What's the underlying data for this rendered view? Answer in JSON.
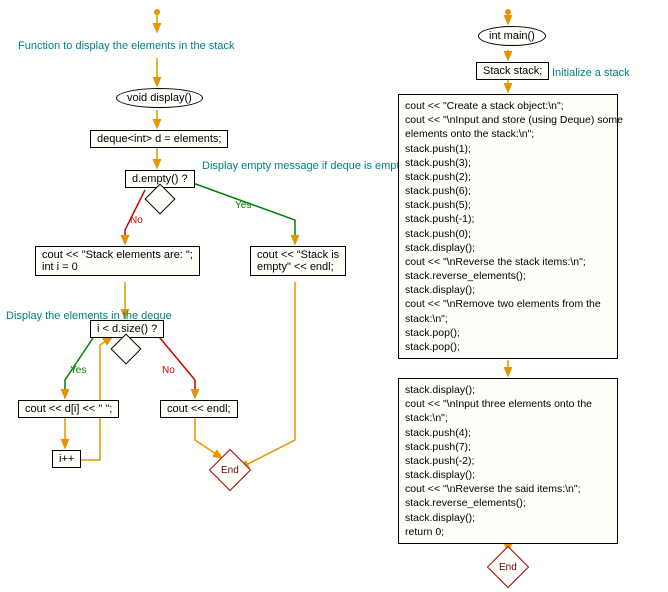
{
  "left": {
    "title_annot": "Function to display the\nelements in the stack",
    "start": "void display()",
    "decl": "deque<int> d = elements;",
    "cond1": "d.empty() ?",
    "cond1_annot": "Display empty message if\ndeque is empty",
    "yes": "Yes",
    "no": "No",
    "branch_no": "cout << \"Stack elements are: \";\nint i = 0",
    "branch_yes": "cout << \"Stack is\nempty\" << endl;",
    "cond2": "i < d.size() ?",
    "cond2_annot": "Display the elements\nin the deque",
    "loop_body": "cout << d[i] << \" \";",
    "inc": "i++",
    "loop_no": "cout << endl;",
    "end": "End"
  },
  "right": {
    "start": "int main()",
    "init": "Stack stack;",
    "init_annot": "Initialize a stack",
    "block1": "cout << \"Create a stack object:\\n\";\ncout << \"\\nInput and store (using Deque) some\nelements onto the stack:\\n\";\nstack.push(1);\nstack.push(3);\nstack.push(2);\nstack.push(6);\nstack.push(5);\nstack.push(-1);\nstack.push(0);\nstack.display();\ncout << \"\\nReverse the stack items:\\n\";\nstack.reverse_elements();\nstack.display();\ncout << \"\\nRemove two elements from the\nstack:\\n\";\nstack.pop();\nstack.pop();",
    "block2": "stack.display();\ncout << \"\\nInput three elements onto the\nstack:\\n\";\nstack.push(4);\nstack.push(7);\nstack.push(-2);\nstack.display();\ncout << \"\\nReverse the said items:\\n\";\nstack.reverse_elements();\nstack.display();\nreturn 0;",
    "end": "End"
  }
}
